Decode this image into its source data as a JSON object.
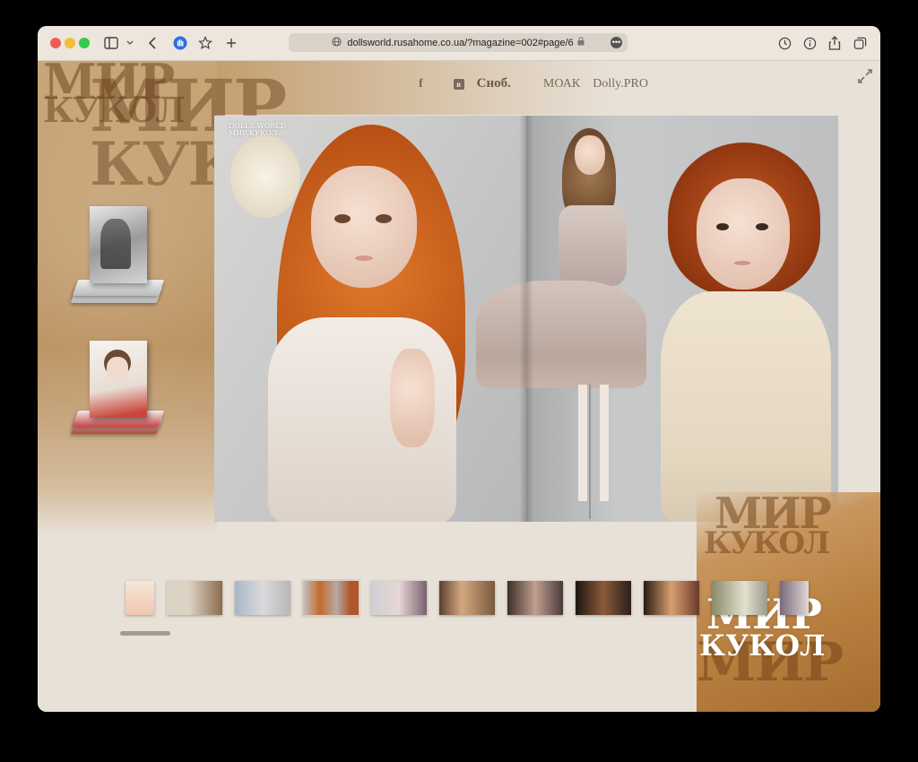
{
  "browser": {
    "url": "dollsworld.rusahome.co.ua/?magazine=002#page/6"
  },
  "site": {
    "logo_line1": "МИР",
    "logo_line2": "КУКОЛ",
    "nav": {
      "facebook": "f",
      "vk": "в",
      "snob": "Сноб.",
      "moak": "МОАК",
      "dolly": "Dolly.PRO"
    }
  },
  "spread": {
    "header_line1": "DOLLS WORLD",
    "header_line2": "МИР КУКОЛ"
  },
  "thumbnails": {
    "count": 11,
    "selected_index": 3
  },
  "colors": {
    "background": "#e8e1d8",
    "brown_accent": "#b8864f"
  }
}
